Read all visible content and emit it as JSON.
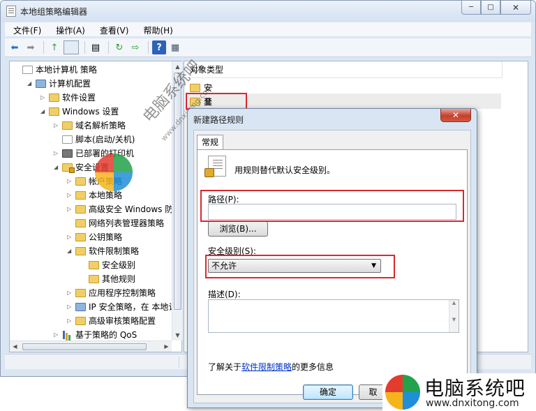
{
  "window": {
    "title": "本地组策略编辑器",
    "caption_min": "─",
    "caption_max": "□",
    "caption_close": "✕"
  },
  "menu": [
    "文件(F)",
    "操作(A)",
    "查看(V)",
    "帮助(H)"
  ],
  "toolbar": {
    "back": "⬅",
    "forward": "➡",
    "up": "↑",
    "doc": "▤",
    "refresh": "↻",
    "export": "⇨",
    "help": "?",
    "props": "▦"
  },
  "tree": [
    {
      "label": "本地计算机 策略",
      "depth": 0,
      "expander": "",
      "icon": "policy-icon"
    },
    {
      "label": "计算机配置",
      "depth": 1,
      "expander": "◢",
      "icon": "computer-icon"
    },
    {
      "label": "软件设置",
      "depth": 2,
      "expander": "▷",
      "icon": "folder-icon"
    },
    {
      "label": "Windows 设置",
      "depth": 2,
      "expander": "◢",
      "icon": "folder-icon"
    },
    {
      "label": "域名解析策略",
      "depth": 3,
      "expander": "▷",
      "icon": "folder-icon"
    },
    {
      "label": "脚本(启动/关机)",
      "depth": 3,
      "expander": "",
      "icon": "script-icon"
    },
    {
      "label": "已部署的打印机",
      "depth": 3,
      "expander": "▷",
      "icon": "printer-icon"
    },
    {
      "label": "安全设置",
      "depth": 3,
      "expander": "◢",
      "icon": "security-folder-icon"
    },
    {
      "label": "帐户策略",
      "depth": 4,
      "expander": "▷",
      "icon": "folder-icon"
    },
    {
      "label": "本地策略",
      "depth": 4,
      "expander": "▷",
      "icon": "folder-icon"
    },
    {
      "label": "高级安全 Windows 防火",
      "depth": 4,
      "expander": "▷",
      "icon": "folder-icon"
    },
    {
      "label": "网络列表管理器策略",
      "depth": 4,
      "expander": "",
      "icon": "folder-icon"
    },
    {
      "label": "公钥策略",
      "depth": 4,
      "expander": "▷",
      "icon": "folder-icon"
    },
    {
      "label": "软件限制策略",
      "depth": 4,
      "expander": "◢",
      "icon": "folder-icon"
    },
    {
      "label": "安全级别",
      "depth": 5,
      "expander": "",
      "icon": "folder-icon"
    },
    {
      "label": "其他规则",
      "depth": 5,
      "expander": "",
      "icon": "folder-icon"
    },
    {
      "label": "应用程序控制策略",
      "depth": 4,
      "expander": "▷",
      "icon": "folder-icon"
    },
    {
      "label": "IP 安全策略，在 本地计",
      "depth": 4,
      "expander": "▷",
      "icon": "ip-security-icon"
    },
    {
      "label": "高级审核策略配置",
      "depth": 4,
      "expander": "▷",
      "icon": "folder-icon"
    },
    {
      "label": "基于策略的 QoS",
      "depth": 3,
      "expander": "▷",
      "icon": "qos-chart-icon"
    }
  ],
  "right_pane": {
    "column_header": "对象类型",
    "items": [
      "安全级别",
      "其他规则"
    ]
  },
  "dialog": {
    "title": "新建路径规则",
    "close": "✕",
    "tab": "常规",
    "description": "用规则替代默认安全级别。",
    "path_label": "路径(P):",
    "path_value": "",
    "browse_label": "浏览(B)...",
    "level_label": "安全级别(S):",
    "level_value": "不允许",
    "desc_label": "描述(D):",
    "desc_value": "",
    "more_info_prefix": "了解关于",
    "more_info_link": "软件限制策略",
    "more_info_suffix": "的更多信息",
    "ok_label": "确定",
    "cancel_label": "取"
  },
  "watermark": {
    "site_cn": "电脑系统吧",
    "site_url": "www.dnxitong.com"
  },
  "brand": {
    "name": "电脑系统吧",
    "url": "www.dnxitong.com",
    "colors": [
      "#e33b2e",
      "#22a24a",
      "#1f8fd8",
      "#f5b41c"
    ]
  }
}
